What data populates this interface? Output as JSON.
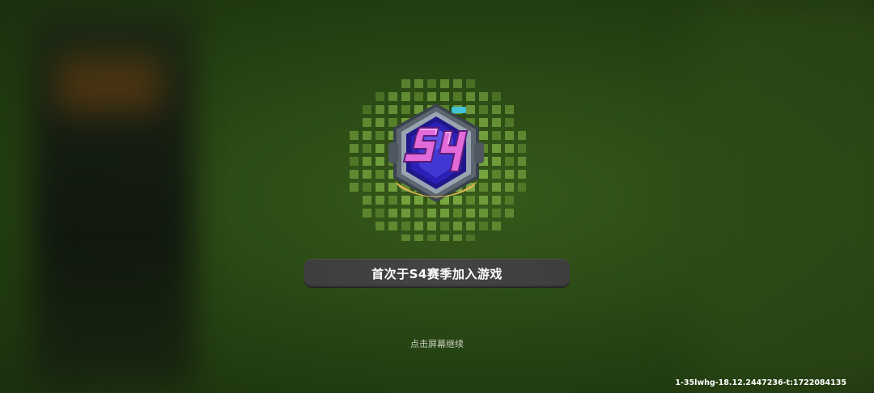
{
  "screen": {
    "name": "season-join-reward-overlay"
  },
  "badge": {
    "season_label": "S4",
    "icon": "season-s4-badge-icon",
    "colors": {
      "pixel_light": "#8fc24d",
      "pixel_dark": "#6e9b37",
      "frame": "#5d6670",
      "frame_light": "#97a5b1",
      "core": "#2a20b8",
      "core_light": "#5149e6",
      "logo": "#e26ad9",
      "logo_light": "#f3a8f3",
      "gold": "#d8b454",
      "accent": "#41c2d6"
    }
  },
  "banner": {
    "text": "首次于S4赛季加入游戏"
  },
  "hint": {
    "text": "点击屏幕继续"
  },
  "build_info": {
    "text": "1-35lwhg-18.12.2447236-t:1722084135"
  },
  "colors": {
    "background": "#2b4a15",
    "banner_bg": "#424242",
    "text_primary": "#ffffff",
    "text_hint": "#c8d3be"
  }
}
